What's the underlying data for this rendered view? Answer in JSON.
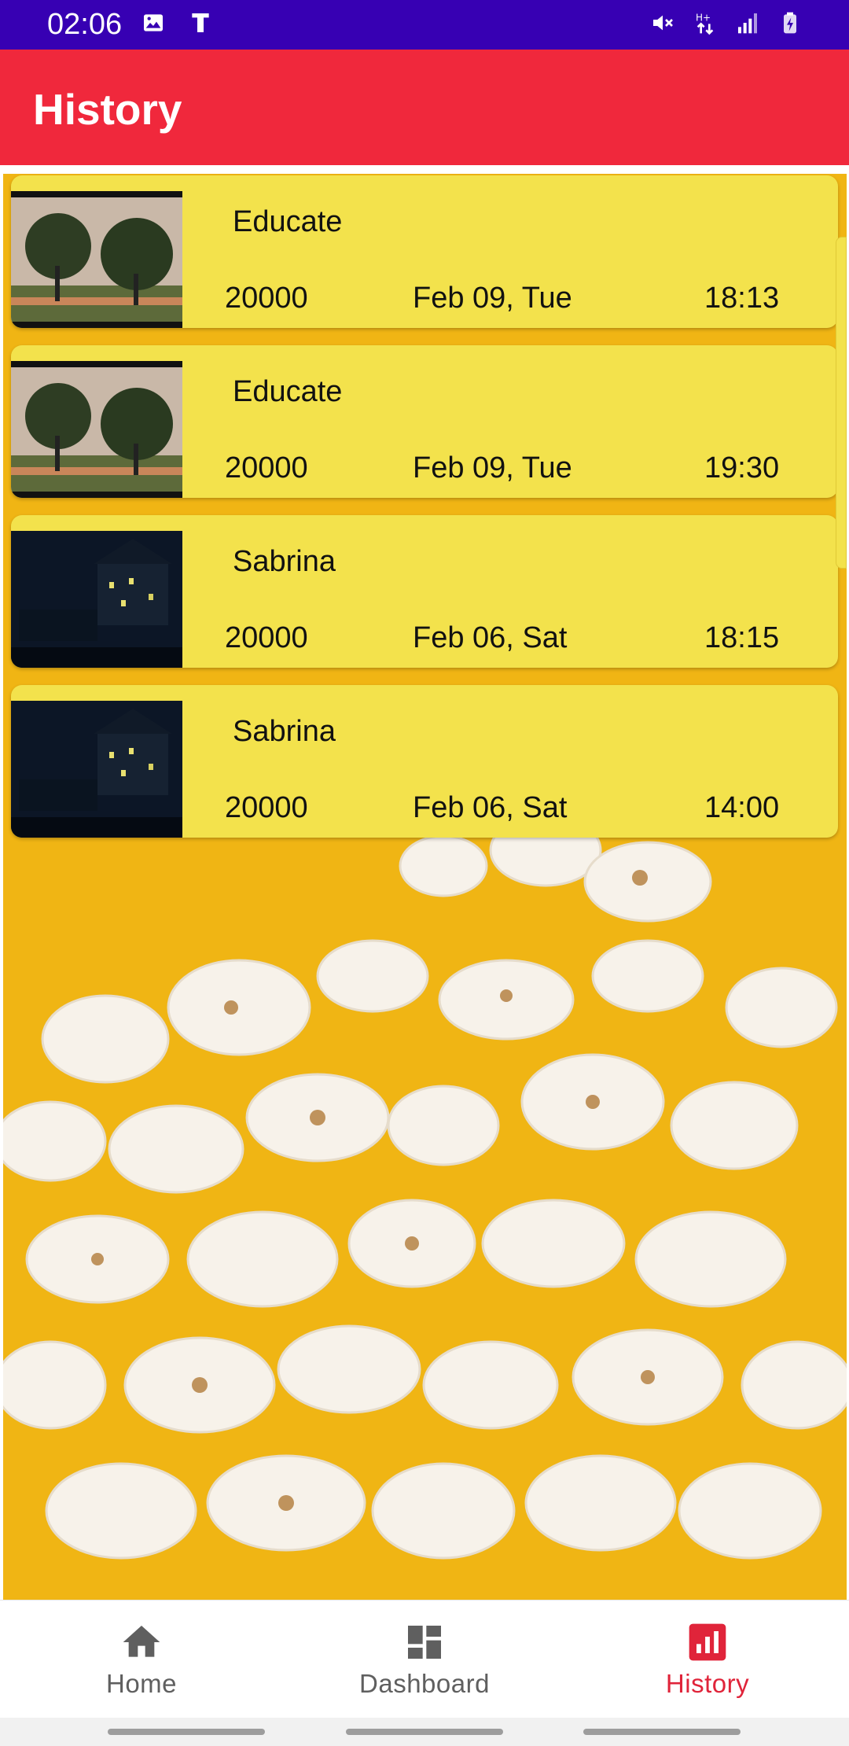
{
  "status_bar": {
    "time": "02:06",
    "left_icons": [
      "image-icon",
      "text-t-icon"
    ],
    "right_icons": [
      "mute-icon",
      "data-arrows-icon",
      "signal-icon",
      "battery-charging-icon"
    ]
  },
  "app_bar": {
    "title": "History"
  },
  "history": [
    {
      "title": "Educate",
      "price": "20000",
      "date": "Feb 09, Tue",
      "time": "18:13",
      "thumbnail": "trees-field"
    },
    {
      "title": "Educate",
      "price": "20000",
      "date": "Feb 09, Tue",
      "time": "19:30",
      "thumbnail": "trees-field"
    },
    {
      "title": "Sabrina",
      "price": "20000",
      "date": "Feb 06, Sat",
      "time": "18:15",
      "thumbnail": "dark-house-night"
    },
    {
      "title": "Sabrina",
      "price": "20000",
      "date": "Feb 06, Sat",
      "time": "14:00",
      "thumbnail": "dark-house-night"
    }
  ],
  "bottom_nav": {
    "items": [
      {
        "label": "Home",
        "icon": "home-icon",
        "active": false
      },
      {
        "label": "Dashboard",
        "icon": "dashboard-icon",
        "active": false
      },
      {
        "label": "History",
        "icon": "history-chart-icon",
        "active": true
      }
    ]
  },
  "colors": {
    "status_bar": "#3700b3",
    "app_bar": "#f0283c",
    "card": "#f3e24c",
    "accent_active": "#e0243a",
    "background_yellow": "#f0b514"
  }
}
